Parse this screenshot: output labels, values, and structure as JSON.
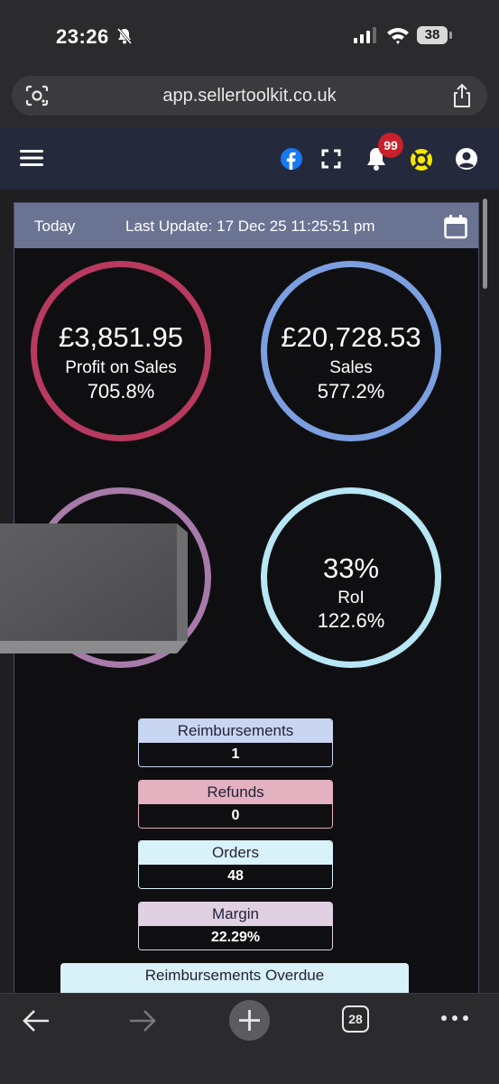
{
  "status_bar": {
    "time": "23:26",
    "battery": "38"
  },
  "browser": {
    "url": "app.sellertoolkit.co.uk",
    "tab_count": "28"
  },
  "navbar": {
    "notification_count": "99",
    "icons": [
      "menu-icon",
      "facebook-icon",
      "fullscreen-icon",
      "bell-icon",
      "support-icon",
      "user-icon"
    ]
  },
  "header": {
    "period": "Today",
    "last_update": "Last Update: 17 Dec 25 11:25:51 pm"
  },
  "kpis": [
    {
      "value": "£3,851.95",
      "label": "Profit on Sales",
      "change": "705.8%",
      "color": "#b83a5e"
    },
    {
      "value": "£20,728.53",
      "label": "Sales",
      "change": "577.2%",
      "color": "#7b9fe0"
    },
    {
      "value": "",
      "label": "",
      "change": "",
      "color": "#a77aa9"
    },
    {
      "value": "33%",
      "label": "RoI",
      "change": "122.6%",
      "color": "#b8e6f5"
    }
  ],
  "stats": [
    {
      "label": "Reimbursements",
      "value": "1",
      "color": "#c9d6f2"
    },
    {
      "label": "Refunds",
      "value": "0",
      "color": "#e3b1bf"
    },
    {
      "label": "Orders",
      "value": "48",
      "color": "#d9f1f9"
    },
    {
      "label": "Margin",
      "value": "22.29%",
      "color": "#e0d0e2"
    }
  ],
  "overdue_label": "Reimbursements Overdue"
}
